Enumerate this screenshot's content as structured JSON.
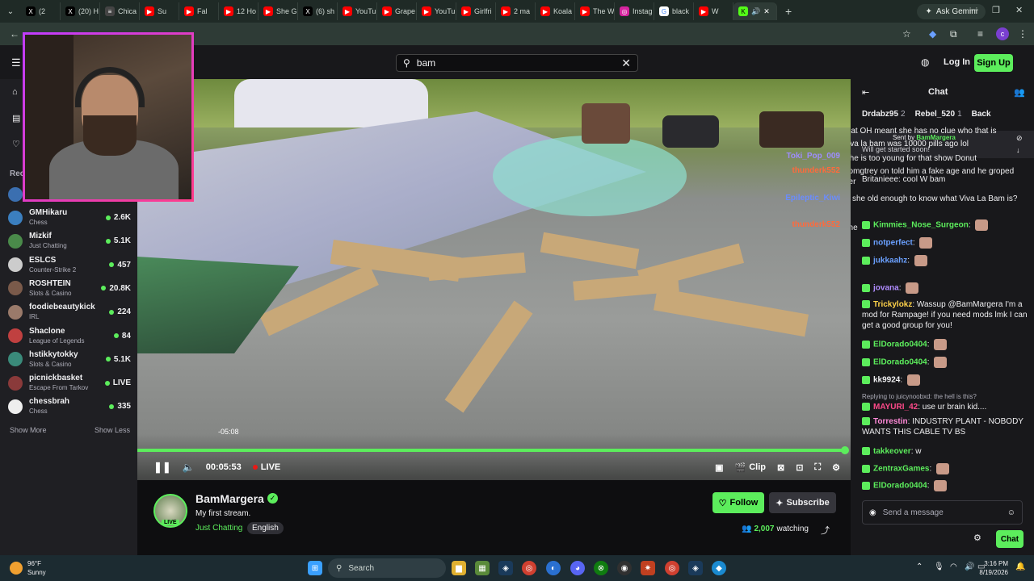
{
  "browser": {
    "tabs": [
      {
        "label": "(2",
        "icon": "x-icon"
      },
      {
        "label": "(20) H",
        "icon": "x-icon"
      },
      {
        "label": "Chica",
        "icon": "page-icon"
      },
      {
        "label": "Su",
        "icon": "youtube-icon"
      },
      {
        "label": "Fal",
        "icon": "youtube-icon"
      },
      {
        "label": "12 Ho",
        "icon": "youtube-icon"
      },
      {
        "label": "She G",
        "icon": "youtube-icon"
      },
      {
        "label": "(6) sh",
        "icon": "x-icon"
      },
      {
        "label": "YouTu",
        "icon": "youtube-icon"
      },
      {
        "label": "Grape",
        "icon": "youtube-icon"
      },
      {
        "label": "YouTu",
        "icon": "youtube-icon"
      },
      {
        "label": "Girlfri",
        "icon": "youtube-icon"
      },
      {
        "label": "2 ma",
        "icon": "youtube-icon"
      },
      {
        "label": "Koala",
        "icon": "youtube-icon"
      },
      {
        "label": "The W",
        "icon": "youtube-icon"
      },
      {
        "label": "Instag",
        "icon": "instagram-icon"
      },
      {
        "label": "black",
        "icon": "google-icon"
      },
      {
        "label": "W",
        "icon": "youtube-icon"
      }
    ],
    "gemini_label": "Ask Gemini",
    "profile_initial": "c"
  },
  "twitch": {
    "search_value": "bam",
    "login_label": "Log In",
    "signup_label": "Sign Up"
  },
  "sidebar": {
    "section_label": "Rec",
    "channels": [
      {
        "name": "GMHikaru",
        "game": "Chess",
        "viewers": "2.6K",
        "color": "#3b7fbf"
      },
      {
        "name": "Mizkif",
        "game": "Just Chatting",
        "viewers": "5.1K",
        "color": "#4a8a4a"
      },
      {
        "name": "ESLCS",
        "game": "Counter-Strike 2",
        "viewers": "457",
        "color": "#cccccc"
      },
      {
        "name": "ROSHTEIN",
        "game": "Slots & Casino",
        "viewers": "20.8K",
        "color": "#7a5a4a"
      },
      {
        "name": "foodiebeautykick",
        "game": "IRL",
        "viewers": "224",
        "color": "#9a7a6a"
      },
      {
        "name": "Shaclone",
        "game": "League of Legends",
        "viewers": "84",
        "color": "#c04040"
      },
      {
        "name": "hstikkytokky",
        "game": "Slots & Casino",
        "viewers": "5.1K",
        "color": "#3a8a7a"
      },
      {
        "name": "picnickbasket",
        "game": "Escape From Tarkov",
        "viewers": "LIVE",
        "color": "#8a3a3a"
      },
      {
        "name": "chessbrah",
        "game": "Chess",
        "viewers": "335",
        "color": "#eeeeee"
      }
    ],
    "show_more": "Show More",
    "show_less": "Show Less"
  },
  "player": {
    "hover_time": "-05:08",
    "elapsed": "00:05:53",
    "live_label": "LIVE",
    "clip_label": "Clip",
    "progress": 1.0
  },
  "stream": {
    "channel": "BamMargera",
    "title": "My first stream.",
    "category": "Just Chatting",
    "tag": "English",
    "live_badge": "LIVE",
    "follow_label": "Follow",
    "subscribe_label": "Subscribe",
    "viewers": "2,007",
    "watching_label": "watching"
  },
  "chat": {
    "title": "Chat",
    "leaderboard": [
      {
        "name": "Drdabz95",
        "count": "2"
      },
      {
        "name": "Rebel_520",
        "count": "1"
      },
      {
        "name": "Back",
        "count": ""
      }
    ],
    "pinned_sent_by": "Sent by",
    "pinned_user": "BamMargera",
    "pinned_text": "Will get started soon!",
    "overlay_lines": [
      {
        "user": "Toki_Pop_009",
        "color": "#9e8cff"
      },
      {
        "user": "thunderk552",
        "color": "#ff6a3c"
      },
      {
        "user": "Epileptic_Kiwi",
        "color": "#6a8cff"
      },
      {
        "user": "thunderk552",
        "color": "#ff6a3c"
      }
    ],
    "overlay_text": [
      "that OH meant she has no clue who that is",
      "viva la bam was 10000 pills ago lol",
      "She is too young for that show Donut",
      "Britanieee: cool W bam",
      "bomgtrey on told him a fake age and he groped her",
      "is she old enough to know what Viva La Bam is?",
      "one"
    ],
    "messages": [
      {
        "user": "Kimmies_Nose_Surgeon",
        "text": "",
        "color": "#5ced5c"
      },
      {
        "user": "notperfect",
        "text": "",
        "color": "#6aa0ff"
      },
      {
        "user": "jukkaahz",
        "text": "",
        "color": "#6aa0ff"
      },
      {
        "user": "jovana",
        "text": "",
        "color": "#b08cff"
      },
      {
        "user": "Trickylokz",
        "text": "Wassup @BamMargera I'm a mod for Rampage! if you need mods lmk I can get a good group for you!",
        "color": "#ffd24a"
      },
      {
        "user": "ElDorado0404",
        "text": "",
        "color": "#5ced5c"
      },
      {
        "user": "ElDorado0404",
        "text": "",
        "color": "#5ced5c"
      },
      {
        "user": "kk9924",
        "text": "",
        "color": "#efeff1"
      },
      {
        "reply": "Replying to juicynoobxd: the hell is this?",
        "user": "MAYURI_42",
        "text": "use ur brain kid....",
        "color": "#ff4a8a"
      },
      {
        "user": "Torrestin",
        "text": "INDUSTRY PLANT - NOBODY WANTS THIS CABLE TV BS",
        "color": "#ff8ad8"
      },
      {
        "user": "takkeover",
        "text": "w",
        "color": "#5ced5c"
      },
      {
        "user": "ZentraxGames",
        "text": "",
        "color": "#5ced5c"
      },
      {
        "user": "ElDorado0404",
        "text": "",
        "color": "#5ced5c"
      }
    ],
    "input_placeholder": "Send a message",
    "chat_button": "Chat"
  },
  "taskbar": {
    "weather_temp": "96°F",
    "weather_desc": "Sunny",
    "search_label": "Search",
    "time": "3:16 PM",
    "date": "8/19/2026"
  },
  "colors": {
    "twitch_green": "#5ced5c",
    "bg": "#0e0e10"
  }
}
